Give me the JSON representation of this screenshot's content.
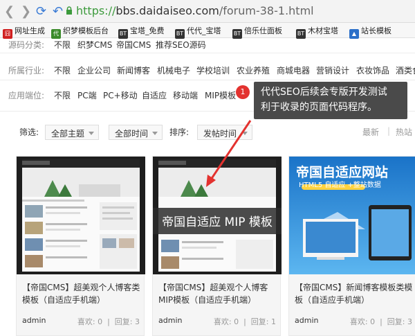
{
  "browser": {
    "url_scheme": "https://",
    "url_domain": "bbs.daidaiseo.com",
    "url_path": "/forum-38-1.html"
  },
  "bookmarks": [
    {
      "label": "网址生成",
      "icon": "囧",
      "color": "#d02020"
    },
    {
      "label": "织梦模板后台",
      "icon": "代",
      "color": "#3a8a2a"
    },
    {
      "label": "宝塔_免费",
      "icon": "BT",
      "color": "#333"
    },
    {
      "label": "代代_宝塔",
      "icon": "BT",
      "color": "#333"
    },
    {
      "label": "倍乐仕面板",
      "icon": "BT",
      "color": "#333"
    },
    {
      "label": "木材宝塔",
      "icon": "BT",
      "color": "#333"
    },
    {
      "label": "站长模板",
      "icon": "▲",
      "color": "#2b6fc9"
    }
  ],
  "filters": {
    "source_label": "源码分类:",
    "source_options": [
      "不限",
      "织梦CMS",
      "帝国CMS",
      "推荐SEO源码"
    ],
    "industry_label": "所属行业:",
    "industry_options": [
      "不限",
      "企业公司",
      "新闻博客",
      "机械电子",
      "学校培训",
      "农业养殖",
      "商城电器",
      "营销设计",
      "衣妆饰品",
      "酒类食"
    ],
    "device_label": "应用端位:",
    "device_options": [
      "不限",
      "PC端",
      "PC+移动",
      "自适应",
      "移动端",
      "MIP模板"
    ]
  },
  "tooltip": {
    "badge": "1",
    "line1": "代代SEO后续会专版开发测试",
    "line2": "利于收录的页面代码程序。"
  },
  "sort_bar": {
    "filter_label": "筛选:",
    "theme_select": "全部主题",
    "time_select": "全部时间",
    "order_label": "排序:",
    "order_select": "发帖时间",
    "newest": "最新",
    "hot": "热站"
  },
  "cards": [
    {
      "title": "【帝国CMS】超美观个人博客类模板（自适应手机端）",
      "author": "admin",
      "likes": "喜欢: 0",
      "replies": "回复: 3"
    },
    {
      "title": "【帝国CMS】超美观个人博客MIP模板（自适应手机端）",
      "author": "admin",
      "likes": "喜欢: 0",
      "replies": "回复: 1",
      "overlay": "帝国自适应 MIP 模板"
    },
    {
      "title": "【帝国CMS】新闻博客模板类模板（自适应手机端）",
      "author": "admin",
      "likes": "喜欢: 0",
      "replies": "回复: 3",
      "banner_title": "帝国自适应网站",
      "banner_sub": "HTML5 自适应 +整站数据"
    }
  ],
  "colors": {
    "accent_red": "#e3322f",
    "tooltip_bg": "#4a4a4a",
    "url_green": "#3c9a3c"
  }
}
